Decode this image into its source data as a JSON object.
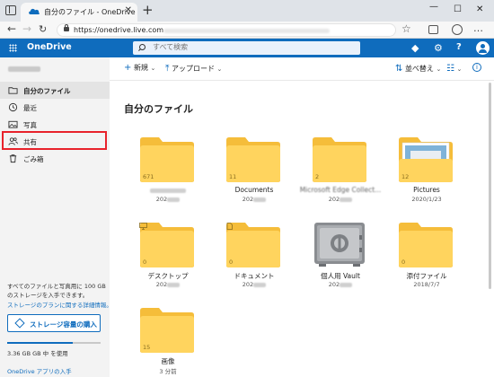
{
  "browser": {
    "tab_title": "自分のファイル - OneDrive",
    "close_glyph": "✕",
    "new_tab_glyph": "+",
    "url": "https://onedrive.live.com",
    "window_controls": {
      "minimize": "—",
      "maximize": "☐",
      "close": "✕"
    },
    "nav": {
      "back": "←",
      "forward": "→",
      "refresh": "↻",
      "favorite": "☆",
      "menu": "…"
    }
  },
  "header": {
    "brand": "OneDrive",
    "search_placeholder": "すべて検索",
    "settings_glyph": "⚙",
    "premium_glyph": "◆",
    "help_glyph": "?"
  },
  "sidebar": {
    "user_name": "",
    "items": [
      {
        "label": "自分のファイル",
        "icon": "folder-icon",
        "active": true
      },
      {
        "label": "最近",
        "icon": "history-icon",
        "active": false
      },
      {
        "label": "写真",
        "icon": "photo-icon",
        "active": false
      },
      {
        "label": "共有",
        "icon": "people-icon",
        "active": false
      },
      {
        "label": "ごみ箱",
        "icon": "trash-icon",
        "active": false
      }
    ],
    "promo_text": "すべてのファイルと写真用に 100 GB のストレージを入手できます。",
    "promo_link": "ストレージのプランに関する詳細情報。",
    "storage_button": "ストレージ容量の購入",
    "storage_fraction": 0.7,
    "storage_text": "3.36 GB GB 中 を使用",
    "app_link": "OneDrive アプリの入手"
  },
  "commandbar": {
    "new": "新規",
    "upload": "アップロード",
    "sort": "並べ替え",
    "plus_glyph": "+",
    "upload_glyph": "⤒",
    "sort_glyph": "⇅",
    "view_glyph": "☷",
    "info_glyph": "i",
    "caret": "⌄"
  },
  "page_title": "自分のファイル",
  "colors": {
    "accent": "#0f6cbd",
    "folder": "#ffd45e",
    "folder_tab": "#f5bd3a",
    "highlight": "#e8222b"
  },
  "files": [
    {
      "name": "",
      "sub": "202",
      "count": "671",
      "badge": "",
      "kind": "folder"
    },
    {
      "name": "Documents",
      "sub": "202",
      "count": "11",
      "badge": "",
      "kind": "folder"
    },
    {
      "name": "Microsoft Edge Collect...",
      "sub": "202",
      "count": "2",
      "badge": "",
      "kind": "folder"
    },
    {
      "name": "Pictures",
      "sub": "2020/1/23",
      "count": "12",
      "badge": "",
      "kind": "pictures"
    },
    {
      "name": "デスクトップ",
      "sub": "202",
      "count": "0",
      "badge": "monitor-icon",
      "kind": "folder"
    },
    {
      "name": "ドキュメント",
      "sub": "202",
      "count": "0",
      "badge": "document-icon",
      "kind": "folder"
    },
    {
      "name": "個人用 Vault",
      "sub": "202",
      "count": "",
      "badge": "",
      "kind": "vault"
    },
    {
      "name": "添付ファイル",
      "sub": "2018/7/7",
      "count": "0",
      "badge": "",
      "kind": "folder"
    },
    {
      "name": "画像",
      "sub": "3 分前",
      "count": "15",
      "badge": "",
      "kind": "folder"
    }
  ]
}
